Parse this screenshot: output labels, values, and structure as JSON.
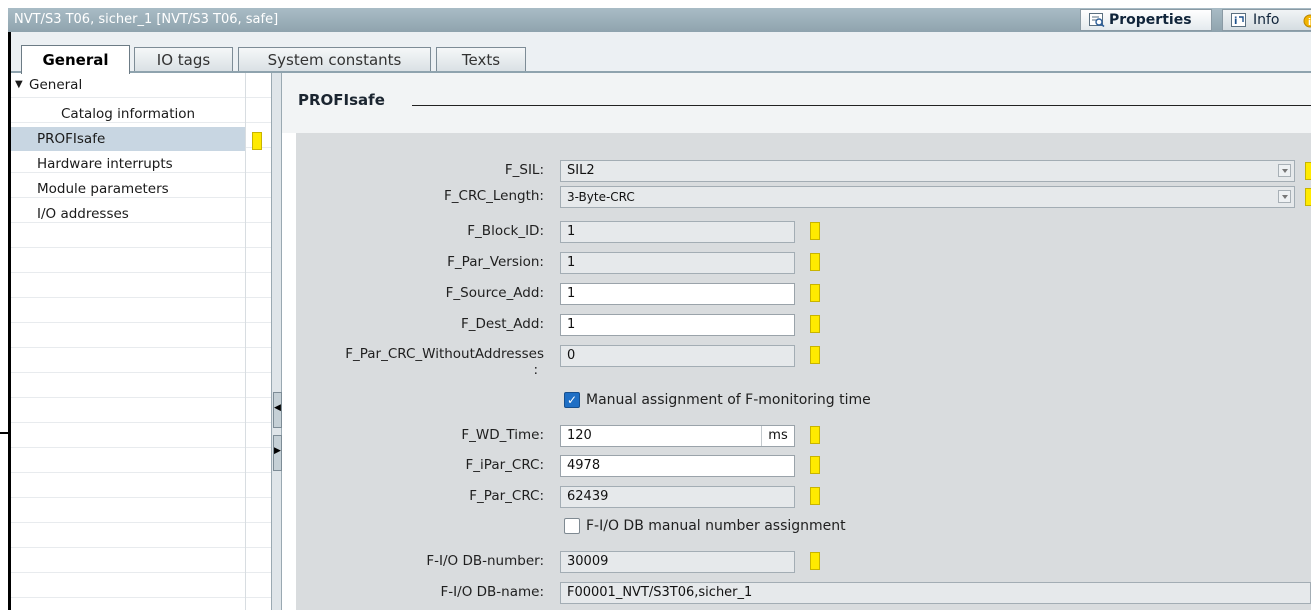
{
  "window": {
    "title": "NVT/S3 T06, sicher_1 [NVT/S3 T06, safe]",
    "properties_tab": "Properties",
    "info_tab": "Info"
  },
  "tabs": [
    "General",
    "IO tags",
    "System constants",
    "Texts"
  ],
  "sidebar": {
    "items": [
      {
        "label": "General",
        "expanded": true
      },
      {
        "label": "Catalog information"
      },
      {
        "label": "PROFIsafe",
        "selected": true
      },
      {
        "label": "Hardware interrupts"
      },
      {
        "label": "Module parameters"
      },
      {
        "label": "I/O addresses"
      }
    ]
  },
  "section": {
    "title": "PROFIsafe"
  },
  "form": {
    "f_sil": {
      "label": "F_SIL:",
      "value": "SIL2"
    },
    "f_crc_length": {
      "label": "F_CRC_Length:",
      "value": "3-Byte-CRC"
    },
    "f_block_id": {
      "label": "F_Block_ID:",
      "value": "1"
    },
    "f_par_version": {
      "label": "F_Par_Version:",
      "value": "1"
    },
    "f_source_add": {
      "label": "F_Source_Add:",
      "value": "1"
    },
    "f_dest_add": {
      "label": "F_Dest_Add:",
      "value": "1"
    },
    "f_par_crc_without": {
      "label_line1": "F_Par_CRC_WithoutAddresses",
      "label_line2": ":",
      "value": "0"
    },
    "manual_monitoring": {
      "label": "Manual assignment of F-monitoring time",
      "checked": true
    },
    "f_wd_time": {
      "label": "F_WD_Time:",
      "value": "120",
      "unit": "ms"
    },
    "f_ipar_crc": {
      "label": "F_iPar_CRC:",
      "value": "4978"
    },
    "f_par_crc": {
      "label": "F_Par_CRC:",
      "value": "62439"
    },
    "db_manual": {
      "label": "F-I/O DB manual number assignment",
      "checked": false
    },
    "db_number": {
      "label": "F-I/O DB-number:",
      "value": "30009"
    },
    "db_name": {
      "label": "F-I/O DB-name:",
      "value": "F00001_NVT/S3T06,sicher_1"
    }
  },
  "colors": {
    "status_marker": "#ffea00",
    "titlebar": "#9aadb7",
    "selected_item": "#c8d6e2",
    "checkbox_checked": "#1f6fc5"
  },
  "icons": {
    "properties": "properties-icon",
    "info": "info-icon",
    "expand": "triangle-down-icon"
  }
}
